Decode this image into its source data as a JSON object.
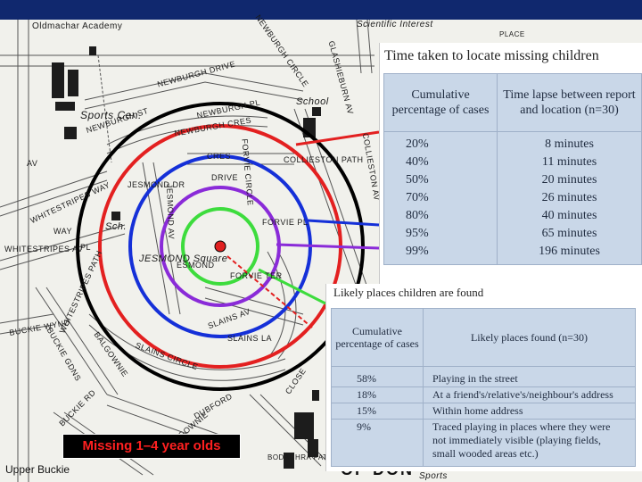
{
  "map": {
    "top_labels": [
      "Oldmachar Academy",
      "Scientific Interest",
      "PLACE"
    ],
    "street_names": [
      "NEWBURGH DRIVE",
      "NEWBURGH ST",
      "NEWBURGH PL",
      "NEWBURGH CRES",
      "NEWBURGH CIRCLE",
      "GLASHIEBURN AV",
      "COLLIESTON PATH",
      "COLLIESTON AV",
      "FORVIE PL",
      "FORVIE CIRCLE",
      "FORVIE TER",
      "JESMOND AV",
      "JESMOND DR",
      "JESMOND Square",
      "WHITESTRIPES WAY",
      "WHITESTRIPES AV",
      "WHITESTRIPES PATH",
      "SLAINS AV",
      "SLAINS LA",
      "SLAINS CIRCLE",
      "BALGOWNIE",
      "DUBFORD",
      "BUCKIE WYND",
      "BUCKIE GDNS",
      "BUCKIE RD",
      "BALGOWNIE",
      "ESMOND",
      "CLOSE",
      "CRES",
      "DRIVE",
      "PL",
      "WAY",
      "AV"
    ],
    "landmarks": {
      "sports": "Sports Cen.",
      "school": "School",
      "sch": "Sch."
    },
    "bottom_left": "Upper Buckie",
    "bottom_right": "OF DON",
    "footer": "Sports",
    "bodachra": "BODACHRA PATH"
  },
  "caption": "Missing 1–4 year olds",
  "table_time": {
    "title": "Time taken to locate missing children",
    "col1_header": "Cumulative percentage of cases",
    "col2_header": "Time lapse between report and location (n=30)",
    "rows": [
      {
        "pct": "20%",
        "time": "8 minutes"
      },
      {
        "pct": "40%",
        "time": "11 minutes"
      },
      {
        "pct": "50%",
        "time": "20 minutes"
      },
      {
        "pct": "70%",
        "time": "26 minutes"
      },
      {
        "pct": "80%",
        "time": "40 minutes"
      },
      {
        "pct": "95%",
        "time": "65 minutes"
      },
      {
        "pct": "99%",
        "time": "196 minutes"
      }
    ]
  },
  "table_places": {
    "title": "Likely places children are found",
    "col1_header": "Cumulative percentage of cases",
    "col2_header": "Likely places found (n=30)",
    "rows": [
      {
        "pct": "58%",
        "place": "Playing in the street"
      },
      {
        "pct": "18%",
        "place": "At a friend's/relative's/neighbour's address"
      },
      {
        "pct": "15%",
        "place": "Within home address"
      },
      {
        "pct": "9%",
        "place": "Traced playing in places where they were not immediately visible (playing fields, small wooded areas etc.)"
      }
    ]
  },
  "colors": {
    "ring_black": "#000000",
    "ring_red": "#e32020",
    "ring_blue": "#1530d8",
    "ring_purple": "#8a2bd8",
    "ring_green": "#3ddc3d",
    "center": "#e02020",
    "table_bg": "#c9d7e8"
  }
}
